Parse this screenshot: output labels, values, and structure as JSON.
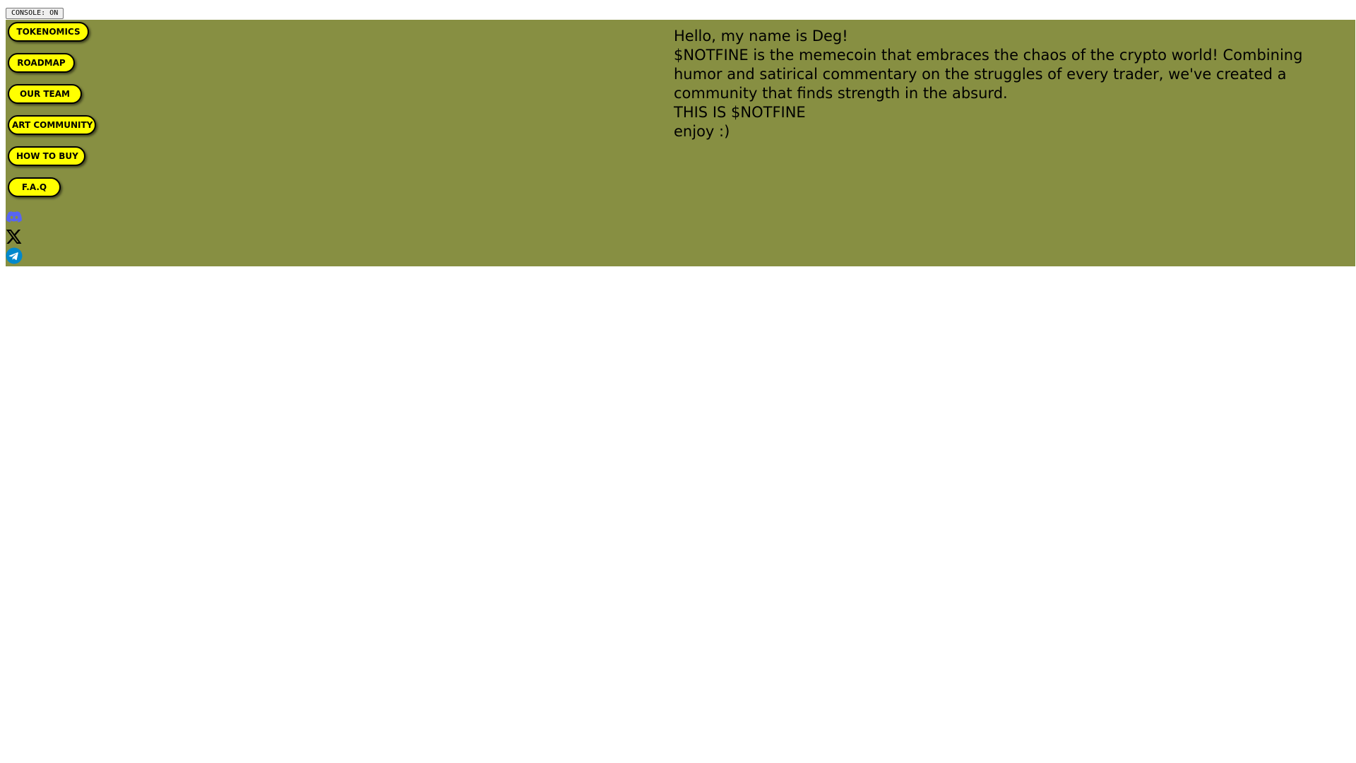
{
  "console_toggle": {
    "label": "CONSOLE: ON"
  },
  "nav": {
    "items": [
      {
        "label": "TOKENOMICS"
      },
      {
        "label": "ROADMAP"
      },
      {
        "label": "OUR TEAM"
      },
      {
        "label": "ART COMMUNITY"
      },
      {
        "label": "HOW TO BUY"
      },
      {
        "label": "F.A.Q"
      }
    ]
  },
  "social": {
    "icons": [
      {
        "name": "discord-icon",
        "color": "#5865f2"
      },
      {
        "name": "x-icon",
        "color": "#000000"
      },
      {
        "name": "telegram-icon",
        "color": "#0088cc"
      }
    ]
  },
  "intro": {
    "greeting": "Hello, my name is Deg!",
    "description": "$NOTFINE is the memecoin that embraces the chaos of the crypto world! Combining humor and satirical commentary on the struggles of every trader, we've created a community that finds strength in the absurd.",
    "tagline": "THIS IS $NOTFINE",
    "signoff": "enjoy :)"
  },
  "colors": {
    "hero_background": "#878f42",
    "button_fill": "#ffff00",
    "button_border": "#000000"
  }
}
